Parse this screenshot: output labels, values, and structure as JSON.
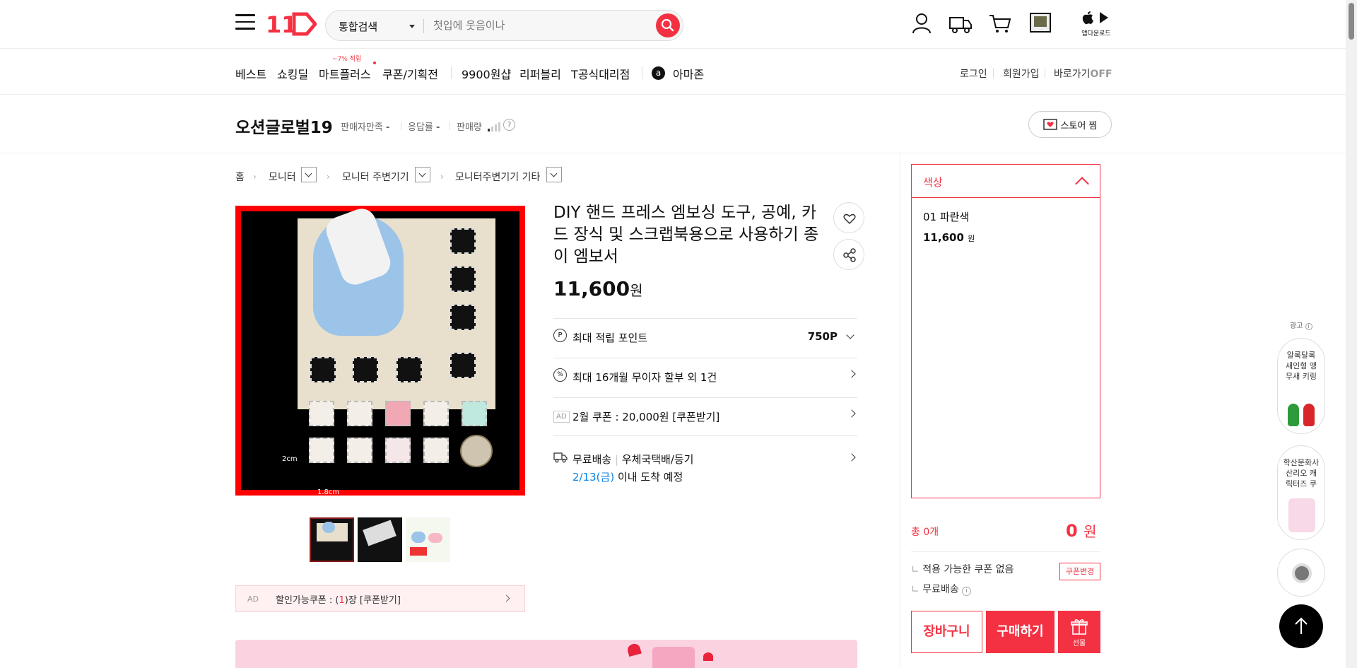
{
  "header": {
    "logo_text": "11",
    "search_category": "통합검색",
    "search_placeholder": "첫입에 웃음이나",
    "app_download": "앱다운로드"
  },
  "gnb": {
    "items": [
      "베스트",
      "쇼킹딜",
      "마트플러스",
      "쿠폰/기획전",
      "9900원샵",
      "리퍼블리",
      "T공식대리점",
      "아마존"
    ],
    "mart_badge": "~7% 적립",
    "login": "로그인",
    "join": "회원가입",
    "baro_label": "바로가기",
    "baro_state": "OFF"
  },
  "seller": {
    "name": "오션글로벌19",
    "satisfaction": "판매자만족",
    "satisfaction_value": "-",
    "response": "응답률",
    "response_value": "-",
    "sales": "판매량",
    "store_button": "스토어 찜"
  },
  "breadcrumb": [
    "홈",
    "모니터",
    "모니터 주변기기",
    "모니터주변기기 기타"
  ],
  "product": {
    "title": "DIY 핸드 프레스 엠보싱 도구, 공예, 카드 장식 및 스크랩북용으로 사용하기 종이 엠보서",
    "price": "11,600",
    "price_unit": "원",
    "image_label_2cm": "2cm",
    "image_label_18cm": "1.8cm"
  },
  "benefits": {
    "point_label": "최대 적립 포인트",
    "point_value": "750P",
    "installment": "최대 16개월 무이자 할부 외 1건",
    "ad_badge": "AD",
    "coupon": "2월 쿠폰 : 20,000원 [쿠폰받기]",
    "shipping_free": "무료배송",
    "shipping_method": "우체국택배/등기",
    "arrival_date": "2/13(금)",
    "arrival_text": "이내 도착 예정"
  },
  "coupon_bar": {
    "ad": "AD",
    "text_before": "할인가능쿠폰 : (",
    "count": "1",
    "text_after": ")장 [쿠폰받기]"
  },
  "options": {
    "header": "색상",
    "item_name": "01 파란색",
    "item_price": "11,600",
    "item_unit": "원"
  },
  "order": {
    "total_label": "총 0개",
    "total_value": "0",
    "total_unit": "원",
    "coupon_none": "적용 가능한 쿠폰 없음",
    "coupon_change": "쿠폰변경",
    "free_ship": "무료배송",
    "cart": "장바구니",
    "buy": "구매하기",
    "gift": "선물"
  },
  "sidebar": {
    "ad_label": "광고",
    "ad1": "알록달록 새인형 앵무새 키링",
    "ad2": "학산문화사 산리오 캐릭터즈 쿠"
  },
  "colors": {
    "accent": "#f43142",
    "blue": "#0b83e6"
  }
}
